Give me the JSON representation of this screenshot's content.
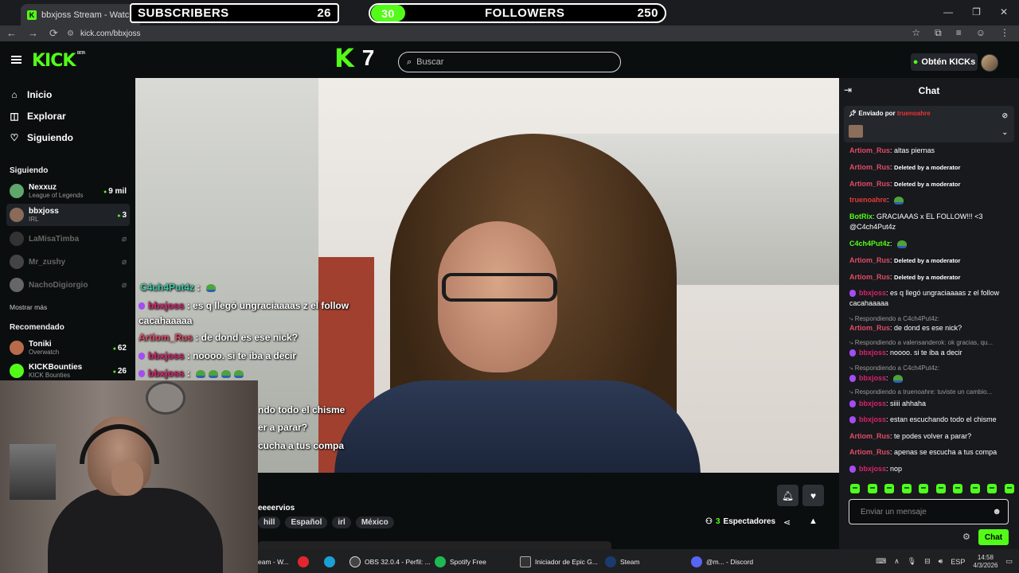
{
  "browser": {
    "tab_title": "bbxjoss Stream - Watch Liv",
    "url": "kick.com/bbxjoss",
    "window_controls": [
      "—",
      "❐",
      "✕"
    ],
    "nav_icons": [
      "←",
      "→",
      "⟳"
    ],
    "right_icons": [
      "☆",
      "⧉",
      "≡",
      "☺",
      "⋮"
    ]
  },
  "overlay": {
    "subscribers_label": "SUBSCRIBERS",
    "subscribers_count": "26",
    "followers_progress": "30",
    "followers_label": "FOLLOWERS",
    "followers_count": "250",
    "k_number": "7"
  },
  "header": {
    "logo": "KICK",
    "logo_badge": "BETA",
    "search_placeholder": "Buscar",
    "get_kicks_label": "Obtén KICKs"
  },
  "sidebar": {
    "nav": [
      {
        "label": "Inicio",
        "icon": "home-icon"
      },
      {
        "label": "Explorar",
        "icon": "compass-icon"
      },
      {
        "label": "Siguiendo",
        "icon": "heart-icon"
      }
    ],
    "following_title": "Siguiendo",
    "following": [
      {
        "name": "Nexxuz",
        "sub": "League of Legends",
        "viewers": "9 mil",
        "color": "#5fa86b"
      },
      {
        "name": "bbxjoss",
        "sub": "IRL",
        "viewers": "3",
        "color": "#8a6a58"
      },
      {
        "name": "LaMisaTimba",
        "sub": "",
        "viewers": "⌀",
        "color": "#333"
      },
      {
        "name": "Mr_zushy",
        "sub": "",
        "viewers": "⌀",
        "color": "#444"
      },
      {
        "name": "NachoDigiorgio",
        "sub": "",
        "viewers": "⌀",
        "color": "#666"
      }
    ],
    "show_more": "Mostrar más",
    "recommended_title": "Recomendado",
    "recommended": [
      {
        "name": "Toniki",
        "sub": "Overwatch",
        "viewers": "62",
        "color": "#b86b4a"
      },
      {
        "name": "KICKBounties",
        "sub": "KICK Bounties",
        "viewers": "26",
        "color": "#53fc18"
      }
    ]
  },
  "video_overlay_chat": [
    {
      "user": "C4ch4Put4z",
      "text": " : "
    },
    {
      "user": "bbxjoss",
      "text": " : es q llegó ungraciaaaas z el follow"
    },
    {
      "user": "",
      "text": "cacahaaaaa"
    },
    {
      "user": "Artiom_Rus",
      "text": " : de dond es ese nick?"
    },
    {
      "user": "bbxjoss",
      "text": " : noooo. si te iba a decir"
    },
    {
      "user": "bbxjoss",
      "text": " : "
    },
    {
      "user": "",
      "text": "ndo todo el chisme"
    },
    {
      "user": "",
      "text": "er a parar?"
    },
    {
      "user": "",
      "text": "cucha a tus compa"
    }
  ],
  "stream": {
    "title_fragment": "eeeervios",
    "tags": [
      "hill",
      "Español",
      "irl",
      "México"
    ],
    "viewers_count": "3",
    "viewers_label": "Espectadores"
  },
  "chat": {
    "title": "Chat",
    "pinned_prefix": "Enviado por",
    "pinned_user": "truenoahre",
    "messages": [
      {
        "user": "Artiom_Rus",
        "cls": "c-art",
        "text": "altas piernas",
        "small": false
      },
      {
        "user": "Artiom_Rus",
        "cls": "c-art",
        "text": "Deleted by a moderator",
        "small": true
      },
      {
        "user": "Artiom_Rus",
        "cls": "c-art",
        "text": "Deleted by a moderator",
        "small": true
      },
      {
        "user": "truenoahre",
        "cls": "c-tru",
        "text": "",
        "small": false
      },
      {
        "user": "BotRix",
        "cls": "c-bot",
        "text": "GRACIAAAS x EL FOLLOW!!! <3 @C4ch4Put4z",
        "small": false
      },
      {
        "user": "C4ch4Put4z",
        "cls": "c-c4",
        "text": "",
        "small": false
      },
      {
        "user": "Artiom_Rus",
        "cls": "c-art",
        "text": "Deleted by a moderator",
        "small": true
      },
      {
        "user": "Artiom_Rus",
        "cls": "c-art",
        "text": "Deleted by a moderator",
        "small": true
      },
      {
        "user": "bbxjoss",
        "cls": "c-bbx",
        "text": "es q llegó ungraciaaaas z el follow cacahaaaaa",
        "small": false
      },
      {
        "reply": "Respondiendo a C4ch4Put4z:"
      },
      {
        "user": "Artiom_Rus",
        "cls": "c-art",
        "text": "de dond es ese nick?",
        "small": false
      },
      {
        "reply": "Respondiendo a valensanderok: ok gracias, qu..."
      },
      {
        "user": "bbxjoss",
        "cls": "c-bbx",
        "text": "noooo. si te iba a decir",
        "small": false
      },
      {
        "reply": "Respondiendo a C4ch4Put4z:"
      },
      {
        "user": "bbxjoss",
        "cls": "c-bbx",
        "text": "",
        "small": false
      },
      {
        "reply": "Respondiendo a truenoahre: tuviste un cambio..."
      },
      {
        "user": "bbxjoss",
        "cls": "c-bbx",
        "text": "siiii ahhaha",
        "small": false
      },
      {
        "user": "bbxjoss",
        "cls": "c-bbx",
        "text": "estan escuchando todo el chisme",
        "small": false
      },
      {
        "user": "Artiom_Rus",
        "cls": "c-art",
        "text": "te podes volver a parar?",
        "small": false
      },
      {
        "user": "Artiom_Rus",
        "cls": "c-art",
        "text": "apenas se escucha a tus compa",
        "small": false
      },
      {
        "user": "bbxjoss",
        "cls": "c-bbx",
        "text": "nop",
        "small": false
      }
    ],
    "input_placeholder": "Enviar un mensaje",
    "send_label": "Chat"
  },
  "taskbar": {
    "items": [
      {
        "label": "eam - W...",
        "color": "#888"
      },
      {
        "label": "",
        "color": "#e3262e"
      },
      {
        "label": "",
        "color": "#1aa0d6"
      },
      {
        "label": "OBS 32.0.4 - Perfil: ...",
        "color": "#444"
      },
      {
        "label": "Spotify Free",
        "color": "#1db954"
      },
      {
        "label": "Iniciador de Epic G...",
        "color": "#333"
      },
      {
        "label": "Steam",
        "color": "#1b3b6f"
      },
      {
        "label": "@m... - Discord",
        "color": "#5865f2"
      }
    ],
    "lang": "ESP",
    "time": "14:58",
    "date": "4/3/2026"
  }
}
